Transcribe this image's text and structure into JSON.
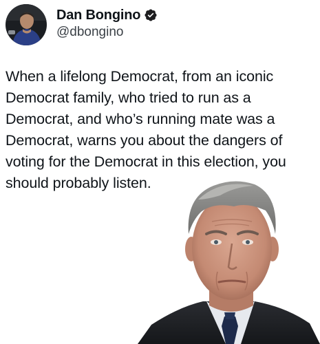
{
  "post": {
    "author": {
      "display_name": "Dan Bongino",
      "handle": "@dbongino",
      "verified": true,
      "verified_icon": "verified-badge-icon",
      "verified_color": "#1d1d1f"
    },
    "text": "When a lifelong Democrat, from an iconic Democrat family, who tried to run as a Democrat, and who’s running mate was a Democrat, warns you about the dangers of voting for the Democrat in this election, you should probably listen."
  },
  "colors": {
    "background": "#ffffff",
    "text": "#0f1419",
    "handle": "#3b4147"
  }
}
